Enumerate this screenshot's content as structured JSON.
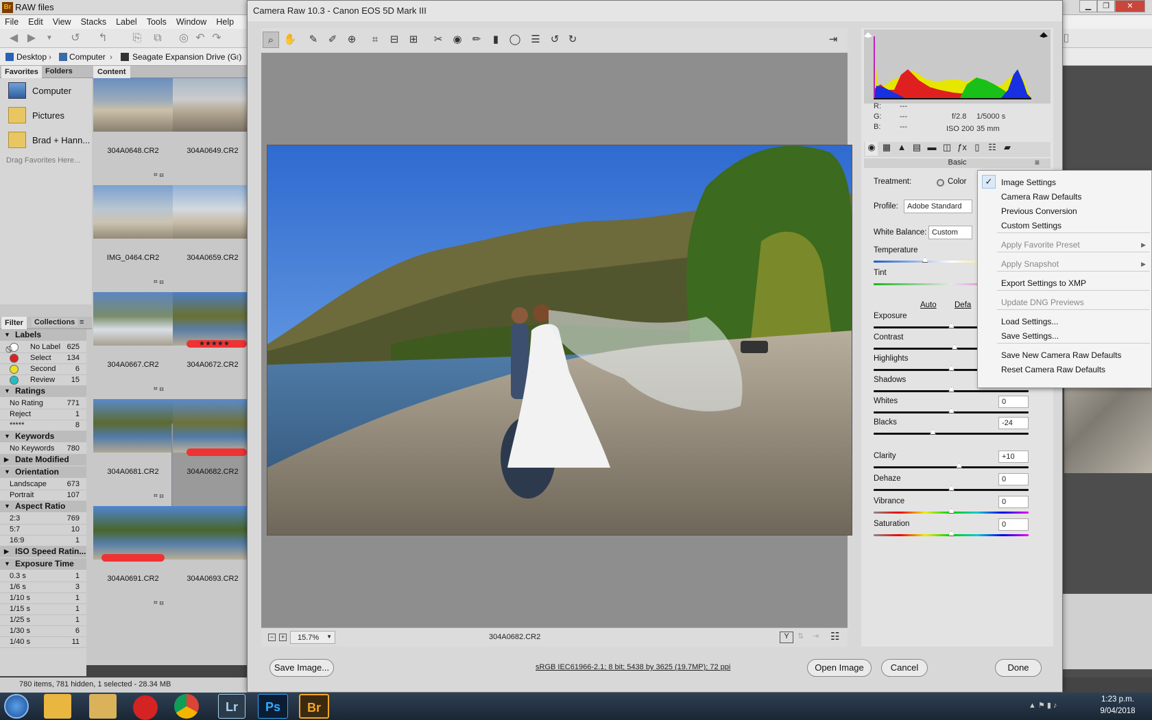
{
  "bridge": {
    "title": "RAW files",
    "menu": [
      "File",
      "Edit",
      "View",
      "Stacks",
      "Label",
      "Tools",
      "Window",
      "Help"
    ],
    "path": [
      "Desktop",
      "Computer",
      "Seagate Expansion Drive (G:)"
    ],
    "tabs": {
      "favorites": "Favorites",
      "folders": "Folders",
      "content": "Content",
      "filter": "Filter",
      "collections": "Collections"
    },
    "favorites": [
      "Computer",
      "Pictures",
      "Brad + Hann..."
    ],
    "drag_hint": "Drag Favorites Here...",
    "filter_sections": [
      {
        "title": "Labels",
        "rows": [
          {
            "n": "No Label",
            "c": "625",
            "dot": "none"
          },
          {
            "n": "Select",
            "c": "134",
            "dot": "#dd2020"
          },
          {
            "n": "Second",
            "c": "6",
            "dot": "#e8e020"
          },
          {
            "n": "Review",
            "c": "15",
            "dot": "#20c0c0"
          }
        ]
      },
      {
        "title": "Ratings",
        "rows": [
          {
            "n": "No Rating",
            "c": "771"
          },
          {
            "n": "Reject",
            "c": "1"
          },
          {
            "n": "*****",
            "c": "8"
          }
        ]
      },
      {
        "title": "Keywords",
        "rows": [
          {
            "n": "No Keywords",
            "c": "780"
          }
        ]
      },
      {
        "title": "Date Modified",
        "collapsed": true,
        "rows": []
      },
      {
        "title": "Orientation",
        "rows": [
          {
            "n": "Landscape",
            "c": "673"
          },
          {
            "n": "Portrait",
            "c": "107"
          }
        ]
      },
      {
        "title": "Aspect Ratio",
        "rows": [
          {
            "n": "2:3",
            "c": "769"
          },
          {
            "n": "5:7",
            "c": "10"
          },
          {
            "n": "16:9",
            "c": "1"
          }
        ]
      },
      {
        "title": "ISO Speed Ratin...",
        "collapsed": true,
        "rows": []
      },
      {
        "title": "Exposure Time",
        "rows": [
          {
            "n": "0.3 s",
            "c": "1"
          },
          {
            "n": "1/6 s",
            "c": "3"
          },
          {
            "n": "1/10 s",
            "c": "1"
          },
          {
            "n": "1/15 s",
            "c": "1"
          },
          {
            "n": "1/25 s",
            "c": "1"
          },
          {
            "n": "1/30 s",
            "c": "6"
          },
          {
            "n": "1/40 s",
            "c": "11"
          }
        ]
      }
    ],
    "thumbs": [
      "304A0648.CR2",
      "304A0649.CR2",
      "IMG_0464.CR2",
      "304A0659.CR2",
      "304A0667.CR2",
      "304A0672.CR2",
      "304A0681.CR2",
      "304A0682.CR2",
      "304A0691.CR2",
      "304A0693.CR2"
    ],
    "rating_stars": "★★★★★",
    "status": "780 items, 781 hidden, 1 selected - 28.34 MB"
  },
  "acr": {
    "title": "Camera Raw 10.3  -  Canon EOS 5D Mark III",
    "zoom": "15.7%",
    "filename": "304A0682.CR2",
    "workflow": "sRGB IEC61966-2.1; 8 bit; 5438 by 3625 (19.7MP); 72 ppi",
    "buttons": {
      "save": "Save Image...",
      "open": "Open Image",
      "cancel": "Cancel",
      "done": "Done"
    },
    "rgb": {
      "r": "R:",
      "g": "G:",
      "b": "B:",
      "dash": "---"
    },
    "exif": {
      "aperture": "f/2.8",
      "shutter": "1/5000 s",
      "iso": "ISO 200",
      "focal": "35 mm"
    },
    "panel_title": "Basic",
    "treatment_label": "Treatment:",
    "treatment_value": "Color",
    "profile_label": "Profile:",
    "profile_value": "Adobe Standard",
    "wb_label": "White Balance:",
    "wb_value": "Custom",
    "auto": "Auto",
    "default": "Defa",
    "sliders": [
      {
        "name": "Temperature"
      },
      {
        "name": "Tint"
      },
      {
        "name": "Exposure"
      },
      {
        "name": "Contrast"
      },
      {
        "name": "Highlights"
      },
      {
        "name": "Shadows"
      },
      {
        "name": "Whites",
        "value": "0"
      },
      {
        "name": "Blacks",
        "value": "-24"
      },
      {
        "name": "Clarity",
        "value": "+10"
      },
      {
        "name": "Dehaze",
        "value": "0"
      },
      {
        "name": "Vibrance",
        "value": "0"
      },
      {
        "name": "Saturation",
        "value": "0"
      }
    ]
  },
  "menu": {
    "items": [
      {
        "label": "Image Settings",
        "checked": true
      },
      {
        "label": "Camera Raw Defaults"
      },
      {
        "label": "Previous Conversion"
      },
      {
        "label": "Custom Settings"
      },
      {
        "label": "Apply Favorite Preset",
        "disabled": true,
        "submenu": true
      },
      {
        "label": "Apply Snapshot",
        "disabled": true,
        "submenu": true
      },
      {
        "label": "Export Settings to XMP"
      },
      {
        "label": "Update DNG Previews",
        "disabled": true
      },
      {
        "label": "Load Settings..."
      },
      {
        "label": "Save Settings..."
      },
      {
        "label": "Save New Camera Raw Defaults"
      },
      {
        "label": "Reset Camera Raw Defaults"
      }
    ]
  },
  "taskbar": {
    "time": "1:23 p.m.",
    "date": "9/04/2018",
    "apps": [
      "Lr",
      "Ps",
      "Br"
    ]
  }
}
